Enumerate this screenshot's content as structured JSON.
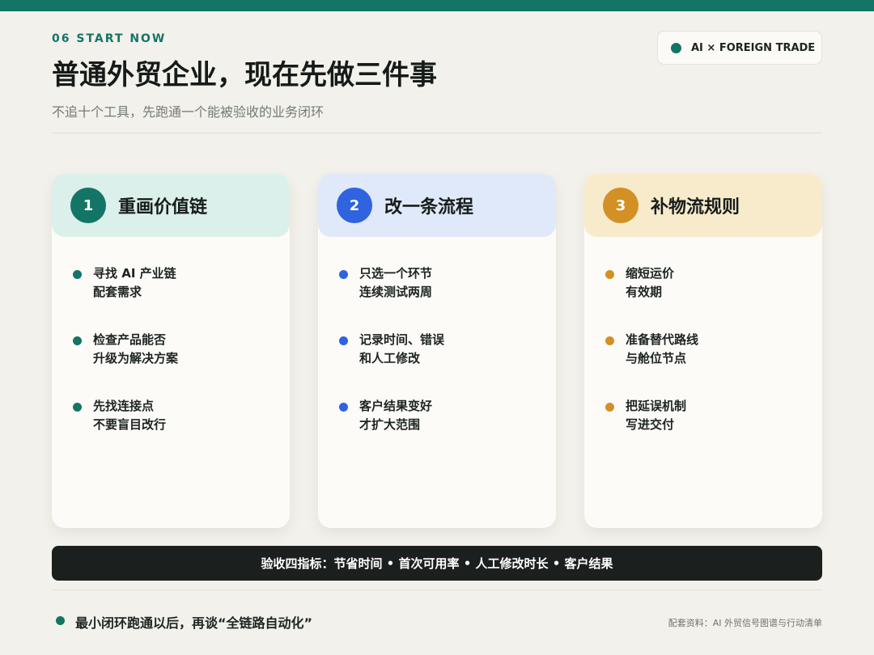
{
  "header": {
    "kicker": "06 START NOW",
    "badge": "AI × FOREIGN TRADE",
    "title": "普通外贸企业，现在先做三件事",
    "subtitle": "不追十个工具，先跑通一个能被验收的业务闭环"
  },
  "cards": [
    {
      "number": "1",
      "title": "重画价值链",
      "accent": "#137566",
      "items": [
        [
          "寻找 AI 产业链",
          "配套需求"
        ],
        [
          "检查产品能否",
          "升级为解决方案"
        ],
        [
          "先找连接点",
          "不要盲目改行"
        ]
      ]
    },
    {
      "number": "2",
      "title": "改一条流程",
      "accent": "#2f63e0",
      "items": [
        [
          "只选一个环节",
          "连续测试两周"
        ],
        [
          "记录时间、错误",
          "和人工修改"
        ],
        [
          "客户结果变好",
          "才扩大范围"
        ]
      ]
    },
    {
      "number": "3",
      "title": "补物流规则",
      "accent": "#d39025",
      "items": [
        [
          "缩短运价",
          "有效期"
        ],
        [
          "准备替代路线",
          "与舱位节点"
        ],
        [
          "把延误机制",
          "写进交付"
        ]
      ]
    }
  ],
  "metrics": "验收四指标：节省时间 • 首次可用率 • 人工修改时长 • 客户结果",
  "footer": {
    "note": "最小闭环跑通以后，再谈“全链路自动化”",
    "source": "配套资料：AI 外贸信号图谱与行动清单"
  }
}
